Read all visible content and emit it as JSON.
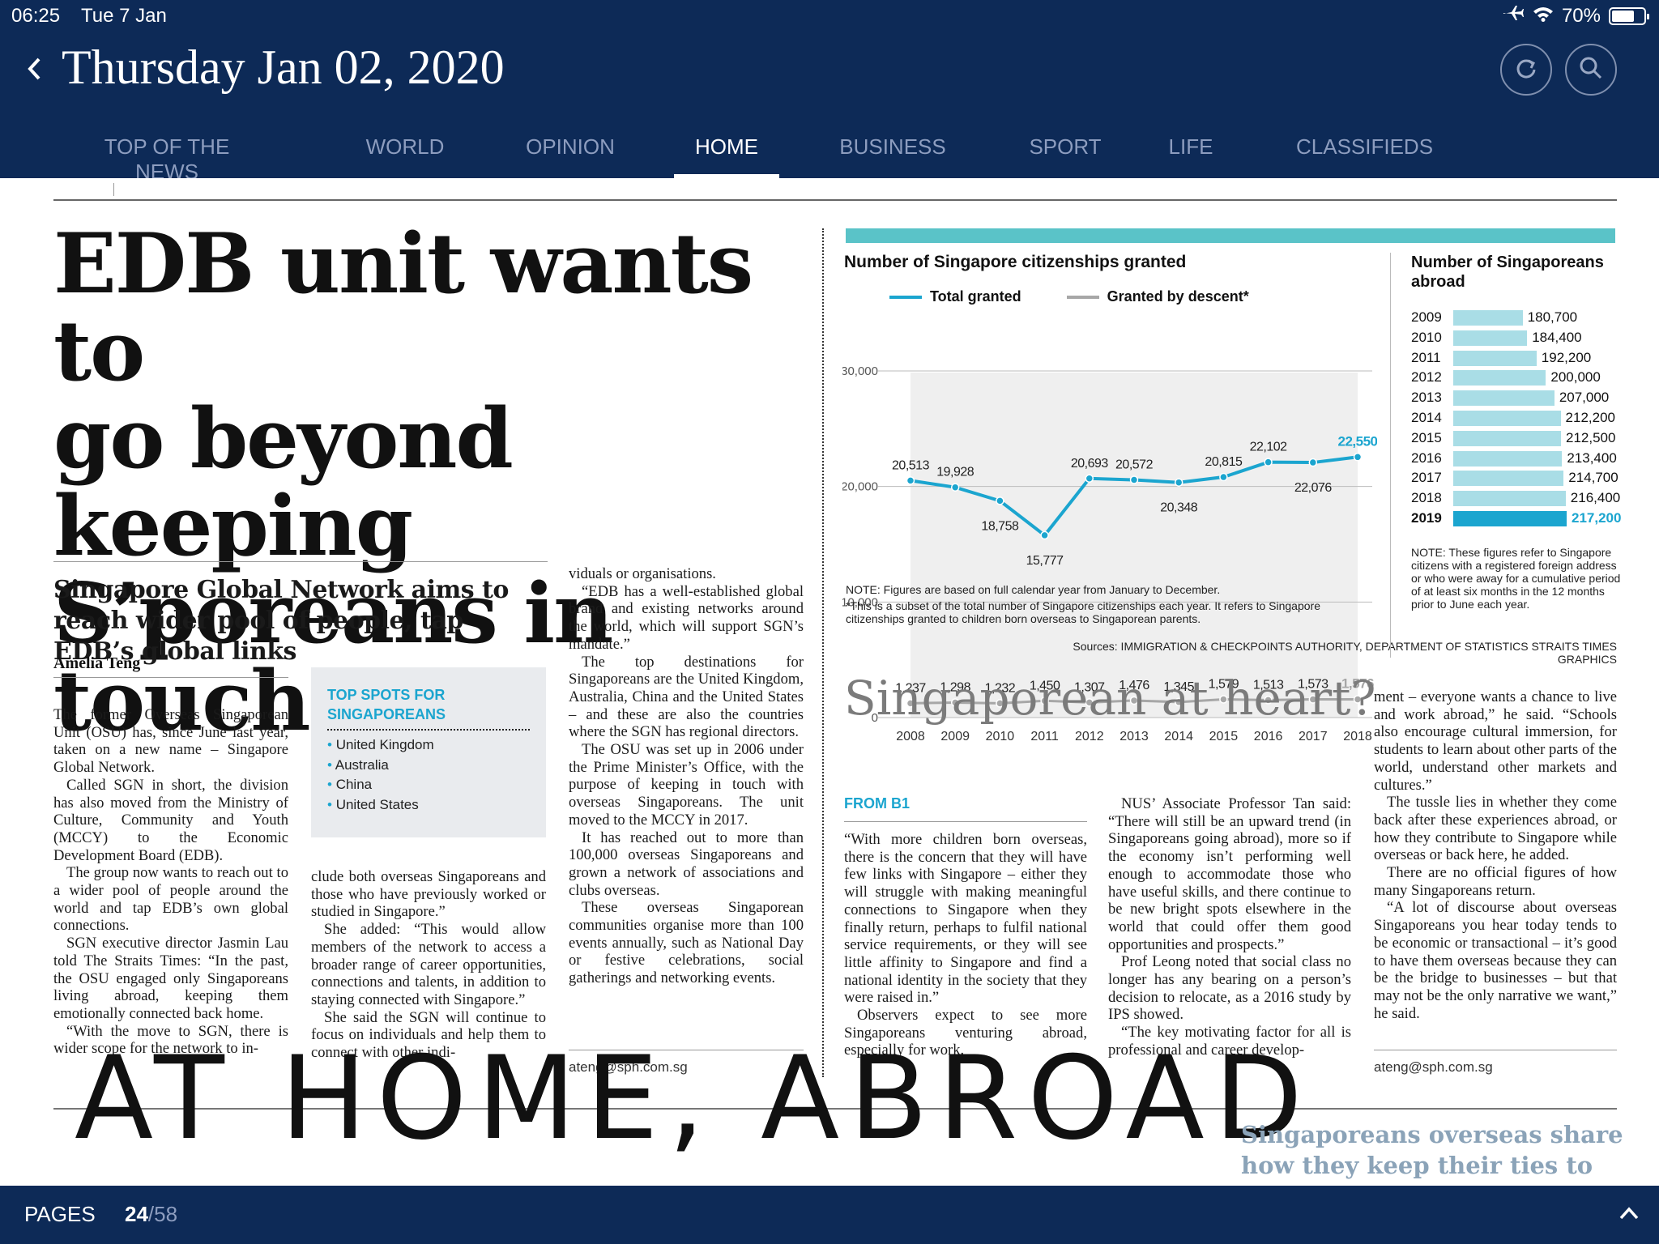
{
  "status_bar": {
    "time": "06:25",
    "date": "Tue 7 Jan",
    "battery": "70%",
    "battery_level": 0.7
  },
  "header": {
    "issue_date": "Thursday Jan 02, 2020"
  },
  "tabs": [
    {
      "label": "TOP OF THE NEWS"
    },
    {
      "label": "WORLD"
    },
    {
      "label": "OPINION"
    },
    {
      "label": "HOME"
    },
    {
      "label": "BUSINESS"
    },
    {
      "label": "SPORT"
    },
    {
      "label": "LIFE"
    },
    {
      "label": "CLASSIFIEDS"
    }
  ],
  "article": {
    "headline": [
      "EDB unit wants to",
      "go beyond keeping",
      "S’poreans in touch"
    ],
    "deck": "Singapore Global Network aims to reach wider pool of people, tap EDB’s global links",
    "byline": "Amelia Teng",
    "col1": [
      "The former Overseas Singaporean Unit (OSU) has, since June last year, taken on a new name – Singapore Global Network.",
      "Called SGN in short, the division has also moved from the Ministry of Culture, Community and Youth (MCCY) to the Economic Development Board (EDB).",
      "The group now wants to reach out to a wider pool of people around the world and tap EDB’s own global connections.",
      "SGN executive director Jasmin Lau told The Straits Times: “In the past, the OSU engaged only Singaporeans living abroad, keeping them emotionally connected back home.",
      "“With the move to SGN, there is wider scope for the network to in-"
    ],
    "col2": [
      "clude both overseas Singaporeans and those who have previously worked or studied in Singapore.”",
      "She added: “This would allow members of the network to access a broader range of career opportunities, connections and talents, in addition to staying connected with Singapore.”",
      "She said the SGN will continue to focus on individuals and help them to connect with other indi-"
    ],
    "col3": [
      "viduals or organisations.",
      "“EDB has a well-established global brand and existing networks around the world, which will support SGN’s mandate.”",
      "The top destinations for Singaporeans are the United Kingdom, Australia, China and the United States – and these are also the countries where the SGN has regional directors.",
      "The OSU was set up in 2006 under the Prime Minister’s Office, with the purpose of keeping in touch with overseas Singaporeans. The unit moved to the MCCY in 2017.",
      "It has reached out to more than 100,000 overseas Singaporeans and grown a network of associations and clubs overseas.",
      "These overseas Singaporean communities organise more than 100 events annually, such as National Day or festive celebrations, social gatherings and networking events."
    ],
    "email": "ateng@sph.com.sg",
    "infobox": {
      "title": "TOP SPOTS FOR SINGAPOREANS",
      "items": [
        "United Kingdom",
        "Australia",
        "China",
        "United States"
      ]
    }
  },
  "graphic": {
    "title": "Number of Singapore citizenships granted",
    "legend": [
      "Total granted",
      "Granted by descent*"
    ],
    "note1": "NOTE: Figures are based on full calendar year from January to December.",
    "note2": "*This is a subset of the total number of Singapore citizenships each year. It refers to Singapore citizenships granted to children born overseas to Singaporean parents.",
    "sources": "Sources: IMMIGRATION & CHECKPOINTS AUTHORITY, DEPARTMENT OF STATISTICS   STRAITS TIMES GRAPHICS",
    "abroad_title": "Number of Singaporeans abroad",
    "abroad_note": "NOTE: These figures refer to Singapore citizens with a registered foreign address or who were away for a cumulative period of at least six months in the 12 months prior to June each year.",
    "colors": {
      "total": "#1ba5cf",
      "descent": "#a7a7a7",
      "bar": "#a9dde6",
      "bar_highlight": "#1ba5cf"
    }
  },
  "chart_data": [
    {
      "type": "line",
      "title": "Number of Singapore citizenships granted",
      "x": [
        2008,
        2009,
        2010,
        2011,
        2012,
        2013,
        2014,
        2015,
        2016,
        2017,
        2018
      ],
      "series": [
        {
          "name": "Total granted",
          "values": [
            20513,
            19928,
            18758,
            15777,
            20693,
            20572,
            20348,
            20815,
            22102,
            22076,
            22550
          ],
          "labels": [
            "20,513",
            "19,928",
            "18,758",
            "15,777",
            "20,693",
            "20,572",
            "20,348",
            "20,815",
            "22,102",
            "22,076",
            "22,550"
          ]
        },
        {
          "name": "Granted by descent*",
          "values": [
            1237,
            1298,
            1232,
            1450,
            1307,
            1476,
            1345,
            1579,
            1513,
            1573,
            1576
          ],
          "labels": [
            "1,237",
            "1,298",
            "1,232",
            "1,450",
            "1,307",
            "1,476",
            "1,345",
            "1,579",
            "1,513",
            "1,573",
            "1,576"
          ]
        }
      ],
      "y_ticks": [
        "30,000",
        "20,000",
        "10,000",
        "0"
      ],
      "ylim": [
        0,
        30000
      ],
      "grid": true,
      "legend_position": "top"
    },
    {
      "type": "bar",
      "orientation": "horizontal",
      "title": "Number of Singaporeans abroad",
      "categories": [
        "2009",
        "2010",
        "2011",
        "2012",
        "2013",
        "2014",
        "2015",
        "2016",
        "2017",
        "2018",
        "2019"
      ],
      "values": [
        180700,
        184400,
        192200,
        200000,
        207000,
        212200,
        212500,
        213400,
        214700,
        216400,
        217200
      ],
      "labels": [
        "180,700",
        "184,400",
        "192,200",
        "200,000",
        "207,000",
        "212,200",
        "212,500",
        "213,400",
        "214,700",
        "216,400",
        "217,200"
      ],
      "highlight": "2019"
    }
  ],
  "story2": {
    "headline": "Singaporean at heart?",
    "from": "FROM B1",
    "col1": [
      "“With more children born overseas, there is the concern that they will have few links with Singapore – either they will struggle with making meaningful connections to Singapore when they finally return, perhaps to fulfil national service requirements, or they will see little affinity to Singapore and find a national identity in the society that they were raised in.”",
      "Observers expect to see more Singaporeans venturing abroad, especially for work."
    ],
    "col2": [
      "NUS’ Associate Professor Tan said: “There will still be an upward trend (in Singaporeans going abroad), more so if the economy isn’t performing well enough to accommodate those who have useful skills, and there continue to be new bright spots elsewhere in the world that could offer them good opportunities and prospects.”",
      "Prof Leong noted that social class no longer has any bearing on a person’s decision to relocate, as a 2016 study by IPS showed.",
      "“The key motivating factor for all is professional and career develop-"
    ],
    "col3": [
      "ment – everyone wants a chance to live and work abroad,” he said. “Schools also encourage cultural immersion, for students to learn about other parts of the world, understand other markets and cultures.”",
      "The tussle lies in whether they come back after these experiences abroad, or how they contribute to Singapore while overseas or back here, he added.",
      "There are no official figures of how many Singaporeans return.",
      "“A lot of discourse about overseas Singaporeans you hear today tends to be economic or transactional – it’s good to have them overseas because they can be the bridge to businesses – but that may not be the only narrative we want,” he said."
    ],
    "email": "ateng@sph.com.sg"
  },
  "banner": {
    "big_text": "AT HOME, ABROAD",
    "teaser": "Singaporeans overseas share how they keep their ties to"
  },
  "bottom_bar": {
    "label": "PAGES",
    "current": "24",
    "total": "/58"
  }
}
